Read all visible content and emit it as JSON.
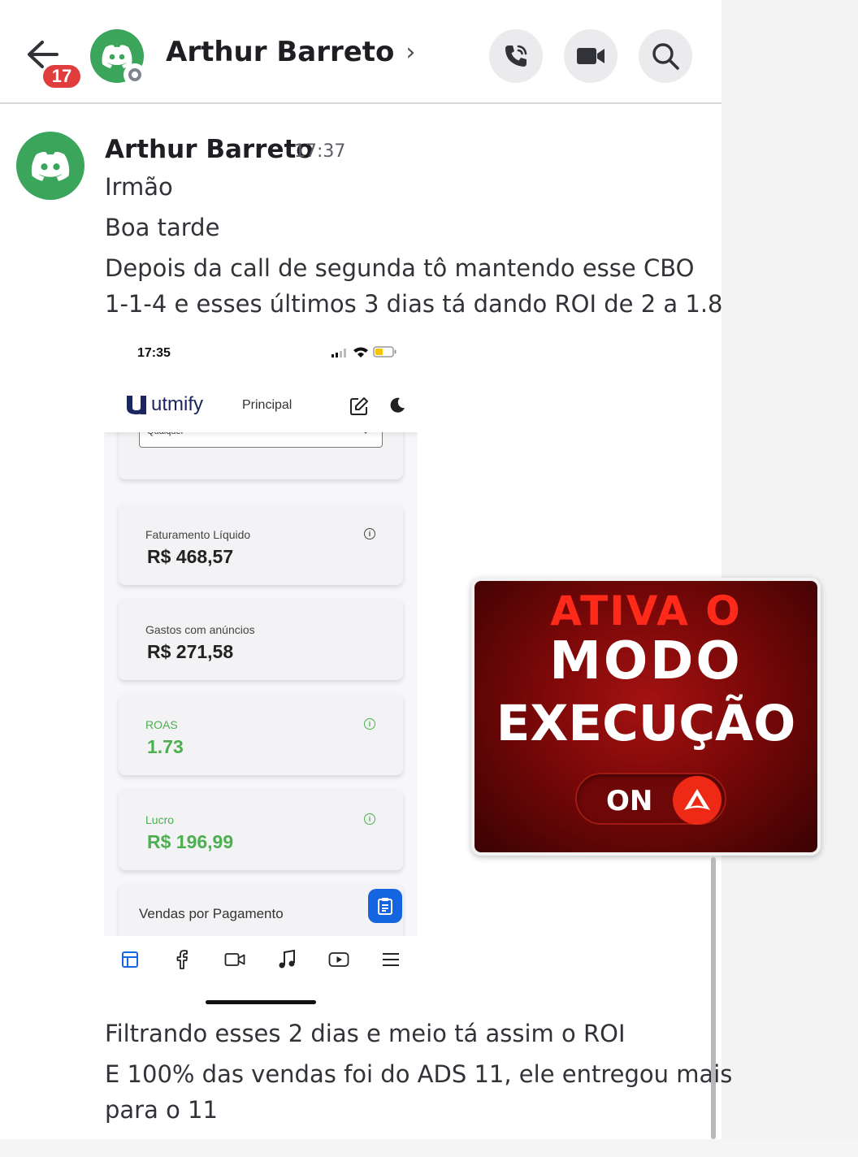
{
  "header": {
    "unread_count": "17",
    "contact_name": "Arthur Barreto",
    "chevron": "›",
    "actions": [
      "phone-call-icon",
      "video-camera-icon",
      "search-icon"
    ]
  },
  "message": {
    "author": "Arthur Barreto",
    "time": "17:37",
    "lines_before": [
      "Irmão",
      "Boa tarde",
      "Depois da call de segunda tô mantendo esse CBO",
      "1-1-4 e esses últimos 3 dias tá dando ROI de 2 a 1.8"
    ],
    "lines_after": [
      "Filtrando esses 2 dias e meio tá assim o ROI",
      "E 100% das vendas foi do ADS 11, ele entregou mais",
      "para o 11"
    ]
  },
  "screenshot": {
    "status_time": "17:35",
    "app_name": "utmify",
    "nav_label": "Principal",
    "filter_value": "Qualquer",
    "cards": [
      {
        "label": "Faturamento Líquido",
        "value": "R$ 468,57",
        "info": "i"
      },
      {
        "label": "Gastos com anúncios",
        "value": "R$ 271,58"
      },
      {
        "label": "ROAS",
        "value": "1.73",
        "info": "i"
      },
      {
        "label": "Lucro",
        "value": "R$ 196,99",
        "info": "i"
      }
    ],
    "section_title": "Vendas por Pagamento",
    "accent_green": "#4caf50",
    "accent_blue": "#1565e0"
  },
  "sticker": {
    "line1": "ATIVA O",
    "line2": "MODO",
    "line3": "EXECUÇÃO",
    "toggle_label": "ON"
  },
  "colors": {
    "discord_green": "#3ba55c",
    "badge_red": "#e03e3e",
    "sticker_red": "#ff2a1a"
  }
}
